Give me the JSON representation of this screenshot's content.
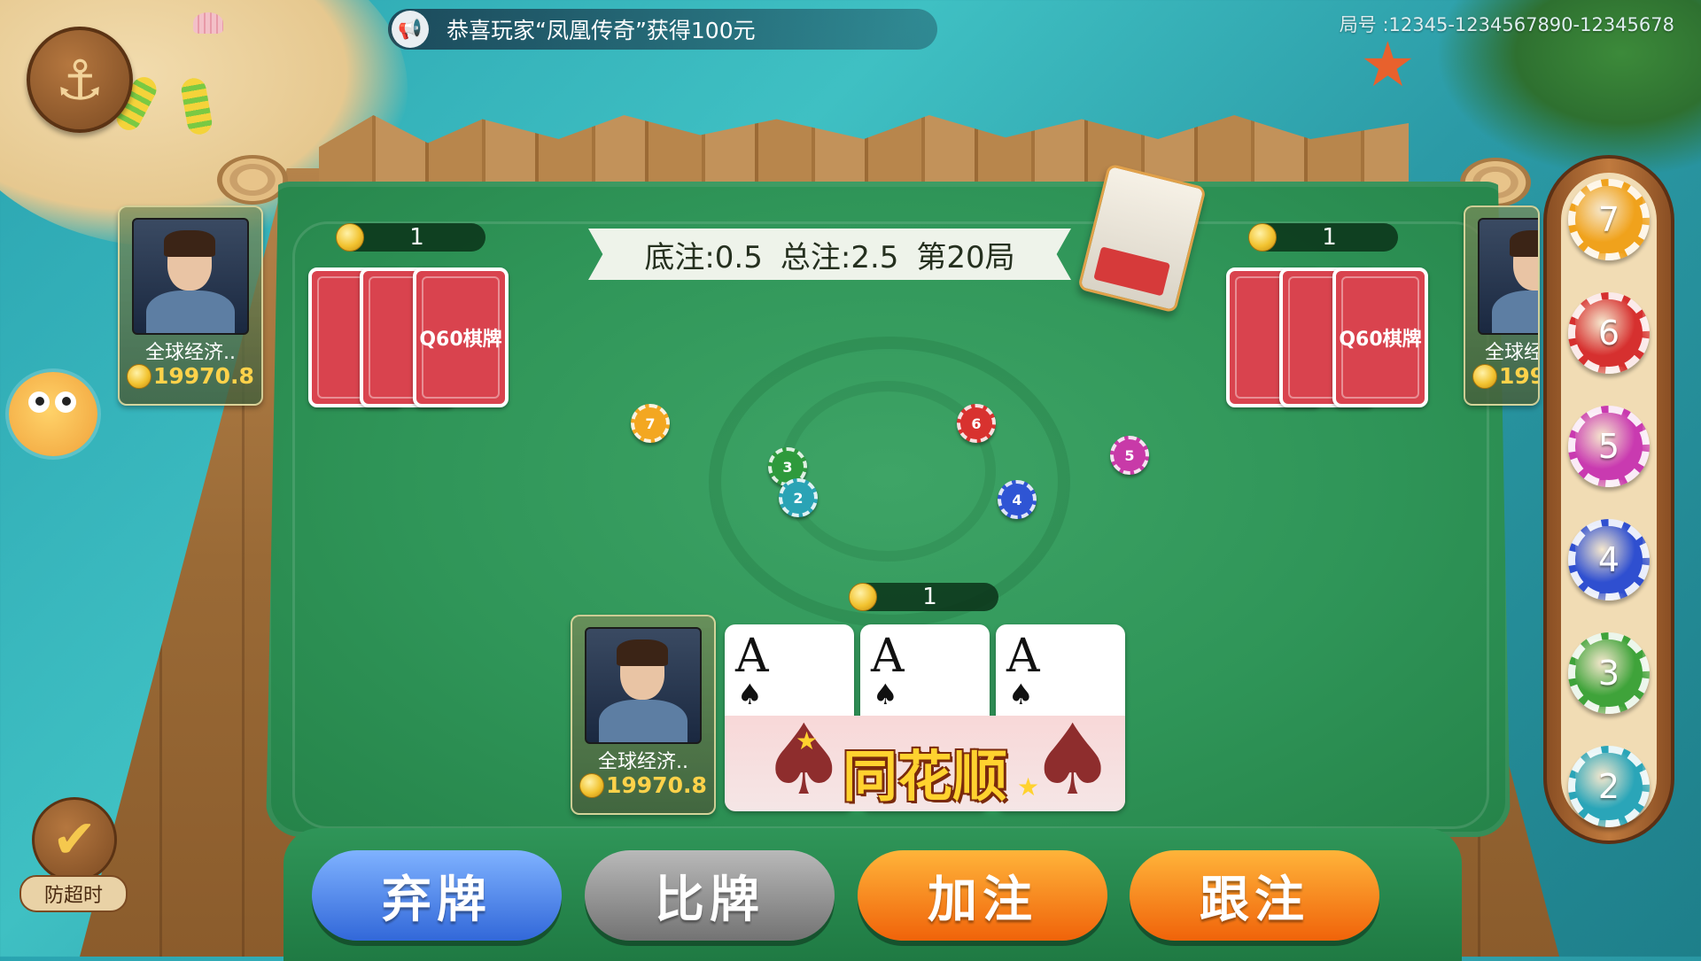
{
  "notice": {
    "text": "恭喜玩家“凤凰传奇”获得100元"
  },
  "room": {
    "id": "局号 :12345-1234567890-12345678"
  },
  "table": {
    "base_bet": "底注:0.5",
    "total_bet": "总注:2.5",
    "round": "第20局"
  },
  "players": [
    {
      "name": "全球经济..",
      "money": "19970.8",
      "bet": "1"
    },
    {
      "name": "全球经",
      "money": "199",
      "bet": "1"
    },
    {
      "name": "全球经济..",
      "money": "19970.8",
      "bet": "1"
    }
  ],
  "card_back_logo": "Q60棋牌",
  "my_cards": [
    {
      "rank": "A",
      "suit": "♠"
    },
    {
      "rank": "A",
      "suit": "♠"
    },
    {
      "rank": "A",
      "suit": "♠"
    }
  ],
  "hand_result": "同花顺",
  "table_chips": [
    {
      "label": "7",
      "color": "#f3a721"
    },
    {
      "label": "6",
      "color": "#d8322f"
    },
    {
      "label": "5",
      "color": "#c83aa8"
    },
    {
      "label": "3",
      "color": "#2e9a3c"
    },
    {
      "label": "2",
      "color": "#2aa3b5"
    },
    {
      "label": "4",
      "color": "#2f55d4"
    }
  ],
  "chip_rail": [
    {
      "label": "7",
      "color": "#f0a21c"
    },
    {
      "label": "6",
      "color": "#d6302f"
    },
    {
      "label": "5",
      "color": "#c93ab0"
    },
    {
      "label": "4",
      "color": "#2f4fd0"
    },
    {
      "label": "3",
      "color": "#3fa33a"
    },
    {
      "label": "2",
      "color": "#2aa5b8"
    }
  ],
  "actions": {
    "fold": "弃牌",
    "compare": "比牌",
    "raise": "加注",
    "call": "跟注"
  },
  "timeout_label": "防超时",
  "icons": {
    "anchor": "anchor-icon",
    "speaker": "speaker-icon",
    "coin": "coin-icon",
    "check": "check-icon"
  }
}
